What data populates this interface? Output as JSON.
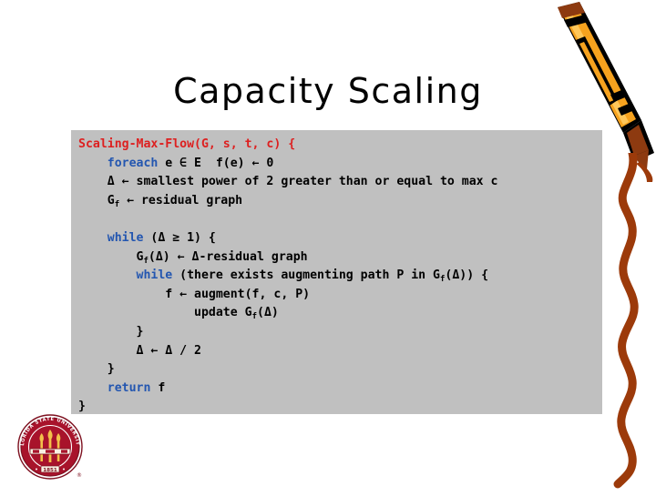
{
  "slide": {
    "title": "Capacity Scaling",
    "background_color": "#ffffff"
  },
  "code_block": {
    "background_color": "#c0c0c0",
    "keyword_red": "#dd2020",
    "keyword_blue": "#2356b0",
    "text_color": "#000000",
    "lines": [
      {
        "id": "line-1",
        "indent": 0,
        "segments": [
          {
            "text": "Scaling-Max-Flow(G, s, t, c) {",
            "color": "red"
          }
        ]
      },
      {
        "id": "line-2",
        "indent": 1,
        "segments": [
          {
            "text": "foreach",
            "color": "blue"
          },
          {
            "text": " e ∈ E  f(e) ← 0",
            "color": "black"
          }
        ]
      },
      {
        "id": "line-3",
        "indent": 1,
        "segments": [
          {
            "text": "Δ ← smallest power of 2 greater than or equal to max c",
            "color": "black"
          }
        ]
      },
      {
        "id": "line-4",
        "indent": 1,
        "segments": [
          {
            "text": "G",
            "color": "black"
          },
          {
            "text": "f",
            "color": "black",
            "sub": true
          },
          {
            "text": " ← residual graph",
            "color": "black"
          }
        ]
      },
      {
        "id": "line-5",
        "indent": 0,
        "segments": [],
        "blank": true
      },
      {
        "id": "line-6",
        "indent": 1,
        "segments": [
          {
            "text": "while",
            "color": "blue"
          },
          {
            "text": " (Δ ≥ 1) {",
            "color": "black"
          }
        ]
      },
      {
        "id": "line-7",
        "indent": 2,
        "segments": [
          {
            "text": "G",
            "color": "black"
          },
          {
            "text": "f",
            "color": "black",
            "sub": true
          },
          {
            "text": "(Δ) ← Δ-residual graph",
            "color": "black"
          }
        ]
      },
      {
        "id": "line-8",
        "indent": 2,
        "segments": [
          {
            "text": "while",
            "color": "blue"
          },
          {
            "text": " (there exists augmenting path P in G",
            "color": "black"
          },
          {
            "text": "f",
            "color": "black",
            "sub": true
          },
          {
            "text": "(Δ)) {",
            "color": "black"
          }
        ]
      },
      {
        "id": "line-9",
        "indent": 3,
        "segments": [
          {
            "text": "f ← augment(f, c, P)",
            "color": "black"
          }
        ]
      },
      {
        "id": "line-10",
        "indent": 4,
        "segments": [
          {
            "text": "update G",
            "color": "black"
          },
          {
            "text": "f",
            "color": "black",
            "sub": true
          },
          {
            "text": "(Δ)",
            "color": "black"
          }
        ]
      },
      {
        "id": "line-11",
        "indent": 2,
        "segments": [
          {
            "text": "}",
            "color": "black"
          }
        ]
      },
      {
        "id": "line-12",
        "indent": 2,
        "segments": [
          {
            "text": "Δ ← Δ / 2",
            "color": "black"
          }
        ]
      },
      {
        "id": "line-13",
        "indent": 1,
        "segments": [
          {
            "text": "}",
            "color": "black"
          }
        ]
      },
      {
        "id": "line-14",
        "indent": 1,
        "segments": [
          {
            "text": "return",
            "color": "blue"
          },
          {
            "text": " f",
            "color": "black"
          }
        ]
      },
      {
        "id": "line-15",
        "indent": 0,
        "segments": [
          {
            "text": "}",
            "color": "black"
          }
        ]
      }
    ]
  },
  "decorations": {
    "crayon": {
      "name": "crayon-pencil",
      "body_color": "#f6a21e",
      "highlight_color": "#ffcc55",
      "outline_color": "#000000",
      "tip_color": "#8d3a10"
    },
    "scribble": {
      "name": "wavy-crayon-line",
      "color": "#9c3a0a"
    },
    "seal": {
      "name": "florida-state-university-seal",
      "ring_color": "#7e1120",
      "field_color": "#a8132b",
      "torch_color": "#f2c14a",
      "ring_text": "FLORIDA STATE UNIVERSITY",
      "year": "1851"
    }
  }
}
